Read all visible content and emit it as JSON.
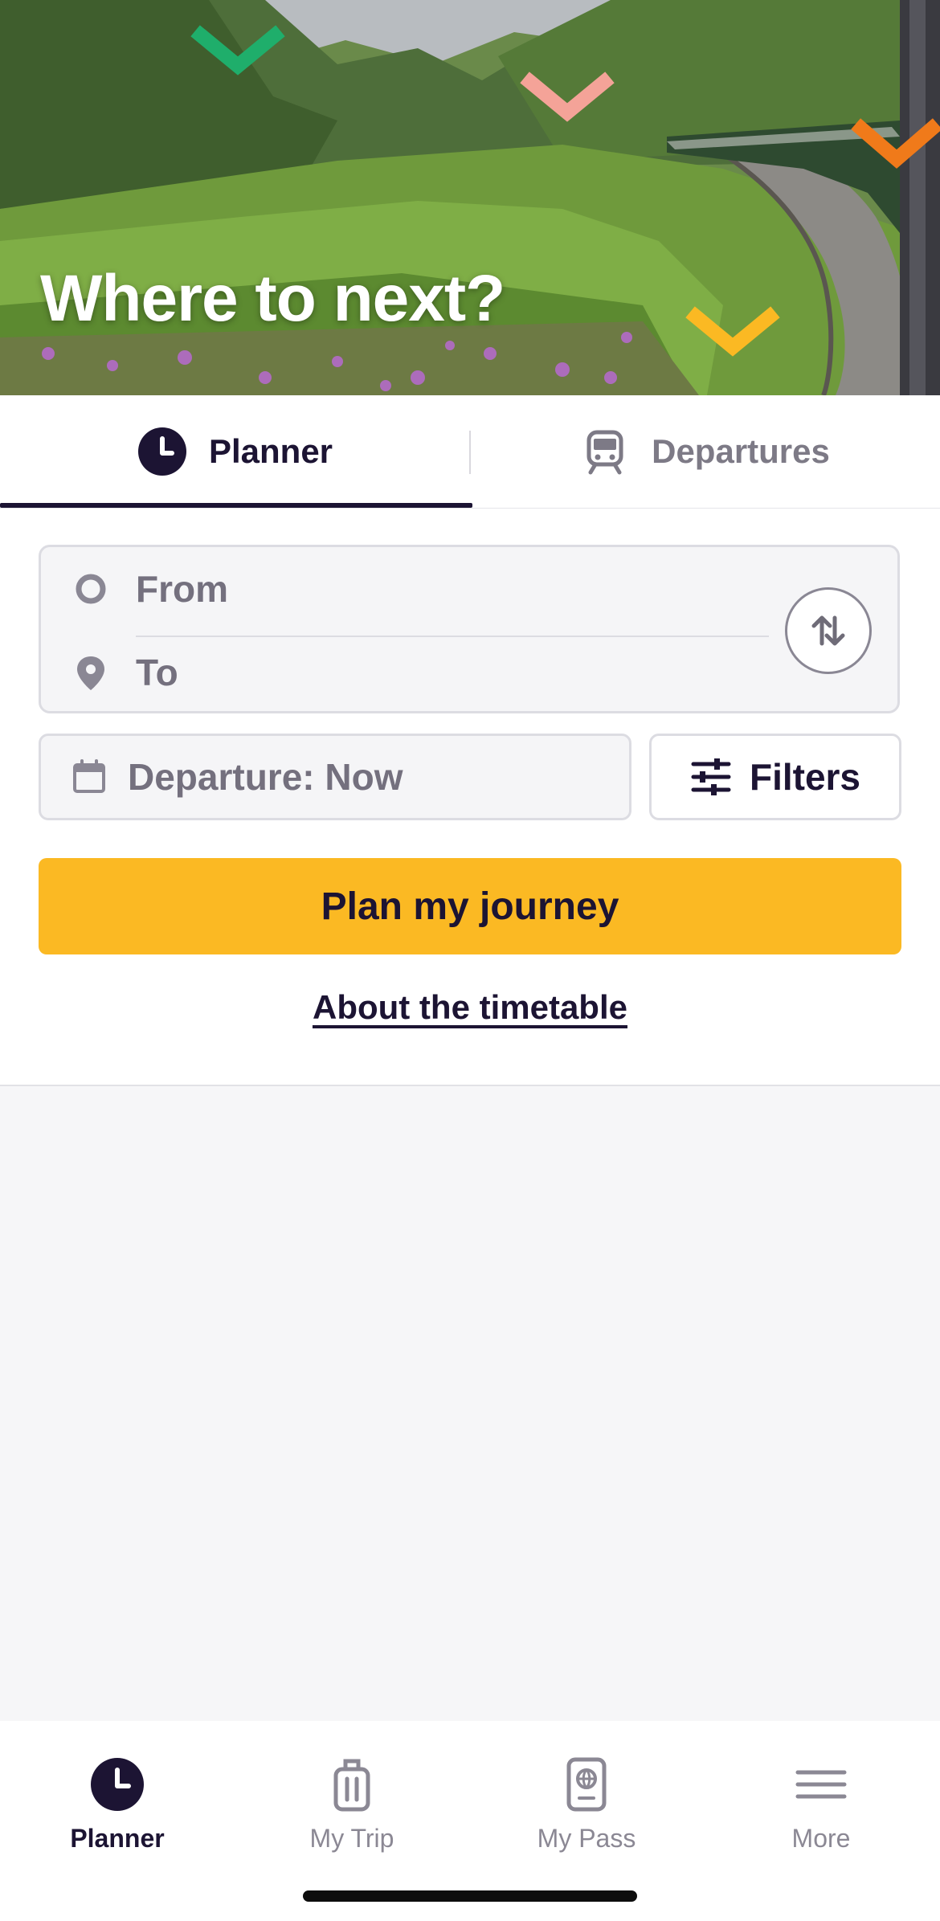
{
  "hero": {
    "title": "Where to next?"
  },
  "tabs": {
    "planner_label": "Planner",
    "departures_label": "Departures",
    "active": "Planner"
  },
  "route": {
    "from_placeholder": "From",
    "to_placeholder": "To"
  },
  "departure": {
    "label": "Departure: Now"
  },
  "filters": {
    "label": "Filters"
  },
  "plan_button": {
    "label": "Plan my journey"
  },
  "about_link": {
    "label": "About the timetable"
  },
  "bottom_nav": {
    "items": [
      {
        "label": "Planner",
        "icon": "clock-icon",
        "active": true
      },
      {
        "label": "My Trip",
        "icon": "suitcase-icon",
        "active": false
      },
      {
        "label": "My Pass",
        "icon": "passport-icon",
        "active": false
      },
      {
        "label": "More",
        "icon": "menu-icon",
        "active": false
      }
    ]
  },
  "colors": {
    "primary_dark": "#1c1433",
    "accent_yellow": "#fbb923",
    "muted_text": "#74707e",
    "chevron_green": "#1fae6b",
    "chevron_pink": "#f4a398",
    "chevron_orange": "#f07a1a",
    "chevron_yellow": "#fbb923"
  }
}
